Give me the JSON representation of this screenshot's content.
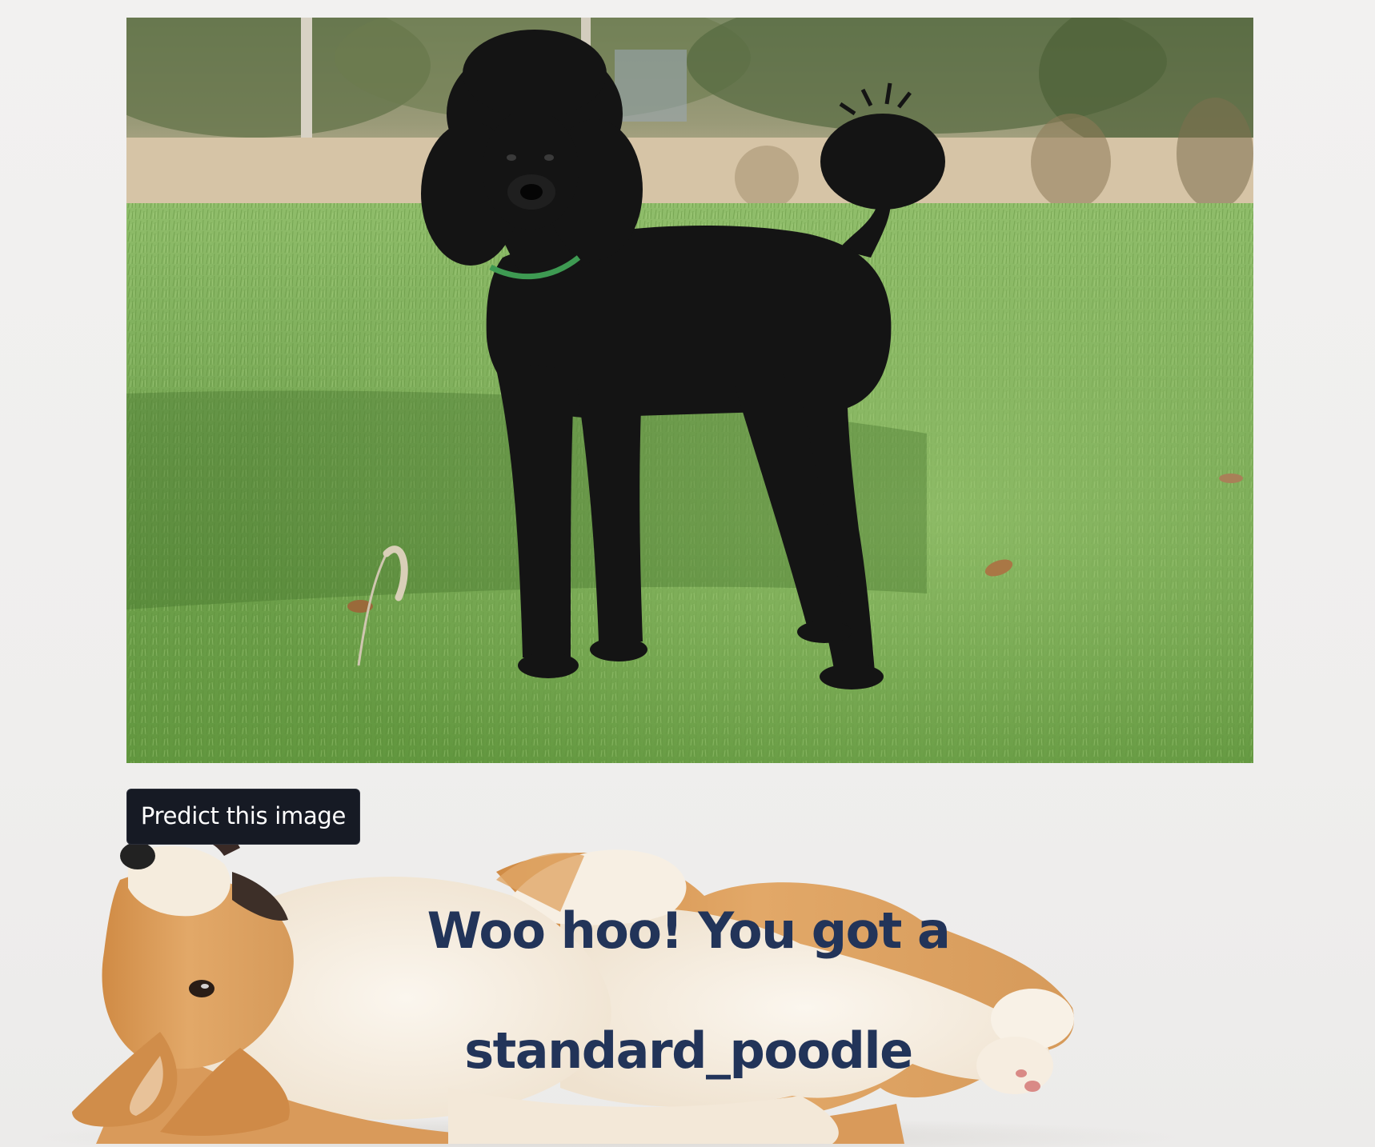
{
  "uploaded_image": {
    "subject_icon": "black-poodle-photo"
  },
  "predict_button": {
    "label": "Predict this image"
  },
  "result": {
    "line1": "Woo hoo! You got a",
    "line2": "standard_poodle"
  },
  "background": {
    "decoration_icon": "corgi-puppy-photo"
  },
  "colors": {
    "button_bg": "#161a24",
    "button_text": "#ffffff",
    "result_text": "#223459",
    "page_bg": "#f0efee"
  }
}
